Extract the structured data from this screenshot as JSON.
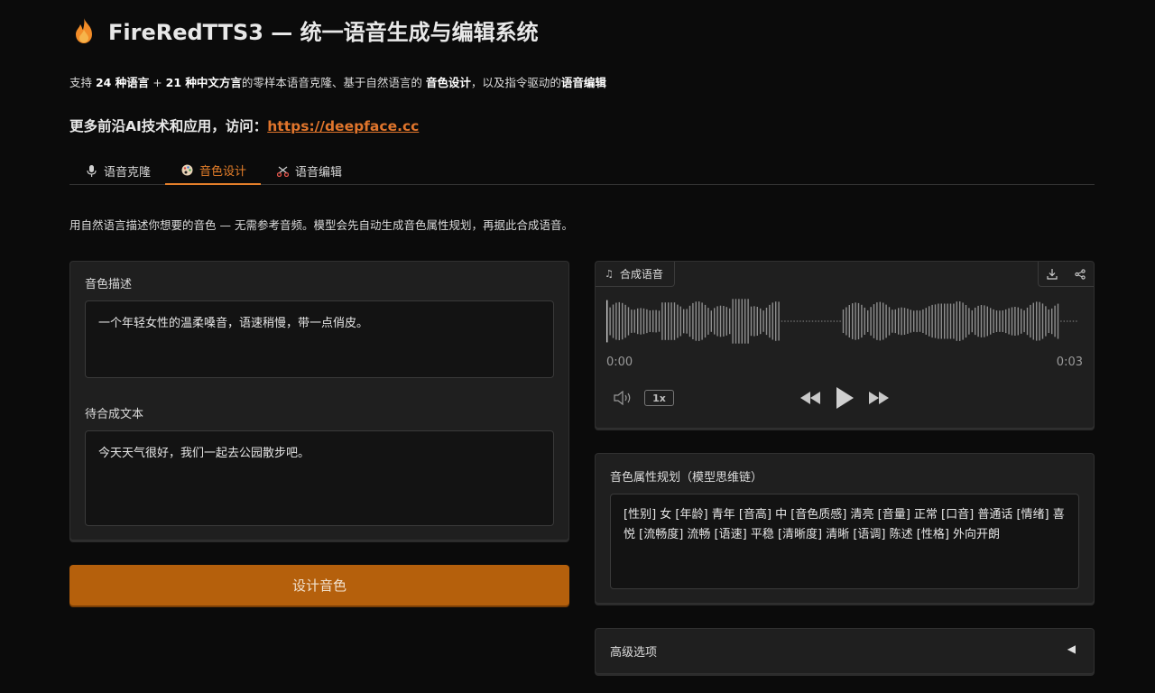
{
  "header": {
    "title": "FireRedTTS3 — 统一语音生成与编辑系统",
    "subtitle": {
      "p1": "支持 ",
      "b1": "24 种语言",
      "p2": " + ",
      "b2": "21 种中文方言",
      "p3": "的零样本语音克隆、基于自然语言的 ",
      "b3": "音色设计",
      "p4": "，以及指令驱动的",
      "b4": "语音编辑"
    },
    "more_label": "更多前沿AI技术和应用，访问：",
    "more_link": "https://deepface.cc"
  },
  "tabs": [
    {
      "label": "语音克隆",
      "icon": "microphone-icon",
      "active": false
    },
    {
      "label": "音色设计",
      "icon": "palette-icon",
      "active": true
    },
    {
      "label": "语音编辑",
      "icon": "scissors-icon",
      "active": false
    }
  ],
  "description": "用自然语言描述你想要的音色 — 无需参考音频。模型会先自动生成音色属性规划，再据此合成语音。",
  "left": {
    "voice_desc_label": "音色描述",
    "voice_desc_value": "一个年轻女性的温柔嗓音，语速稍慢，带一点俏皮。",
    "text_label": "待合成文本",
    "text_value": "今天天气很好，我们一起去公园散步吧。",
    "button_label": "设计音色"
  },
  "audio": {
    "label": "合成语音",
    "time_start": "0:00",
    "time_end": "0:03",
    "speed": "1x"
  },
  "plan": {
    "label": "音色属性规划（模型思维链）",
    "value": "[性别] 女 [年龄] 青年 [音高] 中 [音色质感] 清亮 [音量] 正常 [口音] 普通话 [情绪] 喜悦 [流畅度] 流畅 [语速] 平稳 [清晰度] 清晰 [语调] 陈述 [性格] 外向开朗"
  },
  "advanced": {
    "label": "高级选项"
  },
  "colors": {
    "accent": "#e57f2a",
    "button": "#b5600c",
    "panel": "#1f1f1f",
    "background": "#0b0b0b"
  }
}
